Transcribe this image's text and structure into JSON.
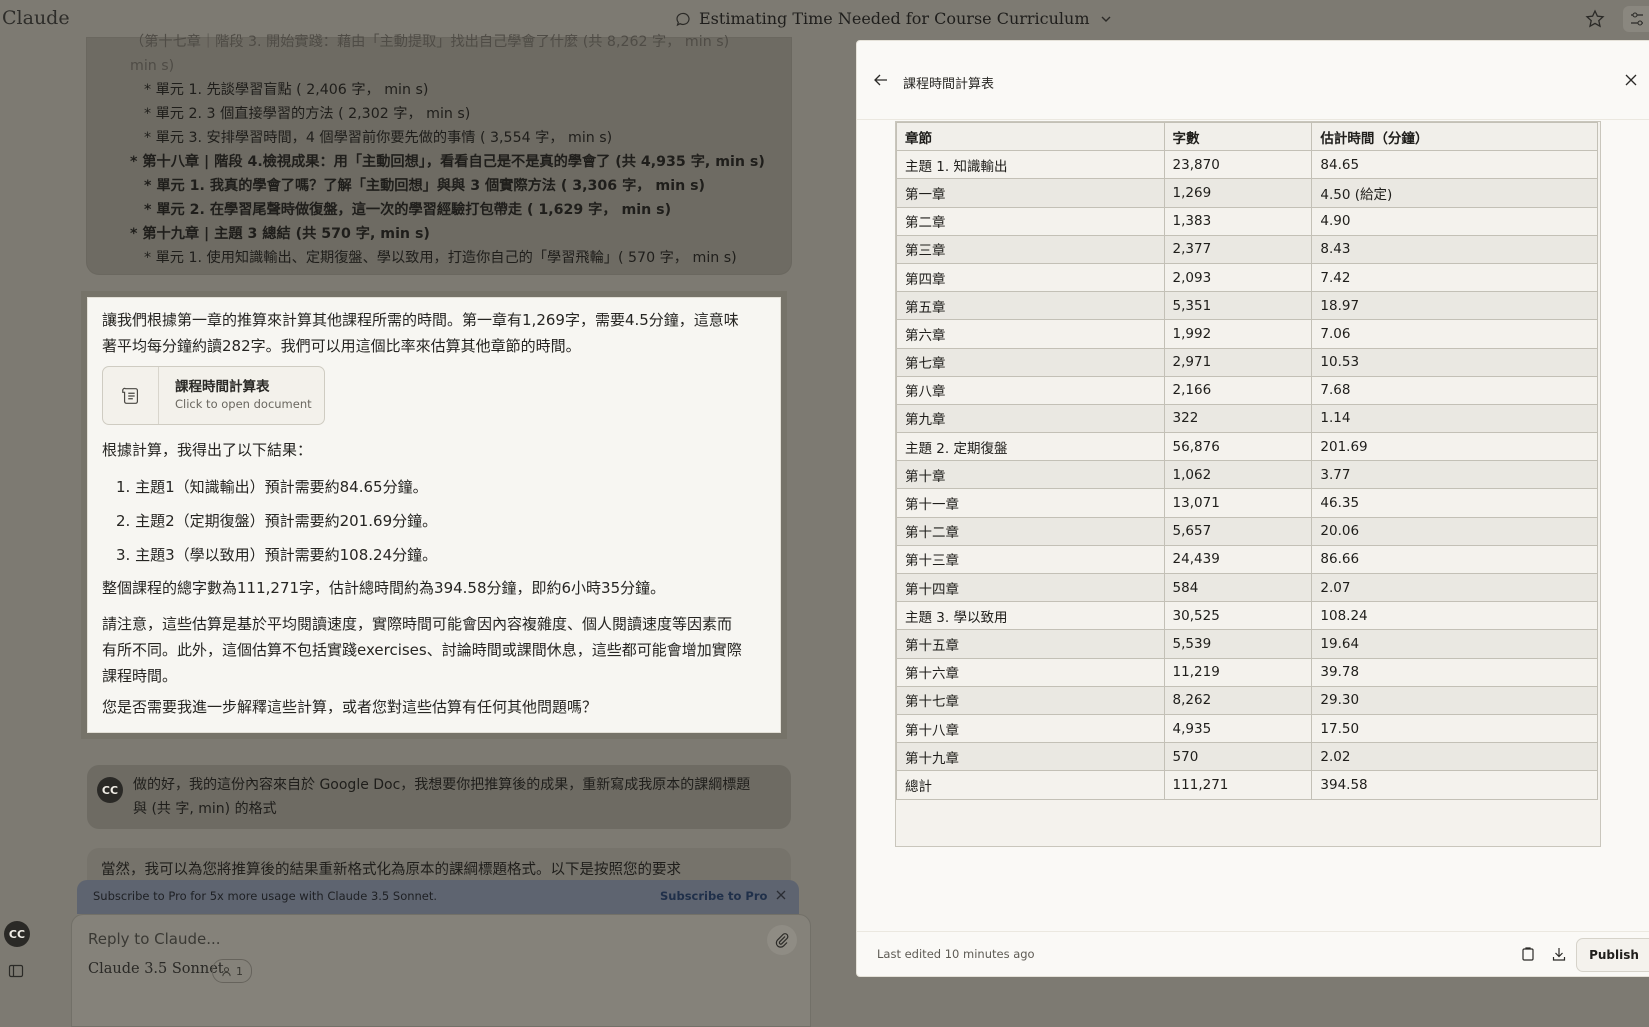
{
  "app": {
    "brand": "Claude",
    "conversation_title": "Estimating Time Needed for Course Curriculum"
  },
  "outline_lines": [
    {
      "text": "（第十七章｜階段 3. 開始實踐：藉由「主動提取」找出自己學會了什麼 (共 8,262 字， min s)",
      "style": "faded"
    },
    {
      "text": "min s)",
      "style": "faded"
    },
    {
      "text": "* 單元 1. 先談學習盲點 ( 2,406 字， min s)",
      "style": "sub"
    },
    {
      "text": "* 單元 2. 3 個直接學習的方法 ( 2,302 字， min s)",
      "style": "sub"
    },
    {
      "text": "* 單元 3. 安排學習時間，4 個學習前你要先做的事情 ( 3,554 字， min s)",
      "style": "sub"
    },
    {
      "text": "* 第十八章 | 階段 4.檢視成果：用「主動回想」，看看自己是不是真的學會了 (共 4,935 字, min s)",
      "style": "bold"
    },
    {
      "text": "* 單元 1. 我真的學會了嗎？了解「主動回想」與與 3 個實際方法 ( 3,306 字， min s)",
      "style": "sub bold"
    },
    {
      "text": "* 單元 2. 在學習尾聲時做復盤，這一次的學習經驗打包帶走 ( 1,629 字， min s)",
      "style": "sub bold"
    },
    {
      "text": "* 第十九章 | 主題 3 總結 (共 570 字, min s)",
      "style": "bold"
    },
    {
      "text": "* 單元 1. 使用知識輸出、定期復盤、學以致用，打造你自己的「學習飛輪」( 570 字， min s)",
      "style": "sub"
    }
  ],
  "ai_message": {
    "intro": "讓我們根據第一章的推算來計算其他課程所需的時間。第一章有1,269字，需要4.5分鐘，這意味著平均每分鐘約讀282字。我們可以用這個比率來估算其他章節的時間。",
    "artifact_chip": {
      "title": "課程時間計算表",
      "subtitle": "Click to open document"
    },
    "results_intro": "根據計算，我得出了以下結果：",
    "results": [
      "1. 主題1（知識輸出）預計需要約84.65分鐘。",
      "2. 主題2（定期復盤）預計需要約201.69分鐘。",
      "3. 主題3（學以致用）預計需要約108.24分鐘。"
    ],
    "total": "整個課程的總字數為111,271字，估計總時間約為394.58分鐘，即約6小時35分鐘。",
    "note": "請注意，這些估算是基於平均閱讀速度，實際時間可能會因內容複雜度、個人閱讀速度等因素而有所不同。此外，這個估算不包括實踐exercises、討論時間或課間休息，這些都可能會增加實際課程時間。",
    "question": "您是否需要我進一步解釋這些計算，或者您對這些估算有任何其他問題嗎？"
  },
  "user_message2": {
    "avatar": "CC",
    "text": "做的好，我的這份內容來自於 Google Doc，我想要你把推算後的成果，重新寫成我原本的課綱標題與 (共 字, min) 的格式"
  },
  "ai_message2_preview": "當然，我可以為您將推算後的結果重新格式化為原本的課綱標題格式。以下是按照您的要求",
  "promo": {
    "text": "Subscribe to Pro for 5x more usage with Claude 3.5 Sonnet.",
    "link": "Subscribe to Pro"
  },
  "composer": {
    "placeholder": "Reply to Claude...",
    "model": "Claude 3.5 Sonnet",
    "badge_count": "1"
  },
  "left_avatar": "CC",
  "artifact": {
    "title": "課程時間計算表",
    "columns": [
      "章節",
      "字數",
      "估計時間（分鐘）"
    ],
    "rows": [
      [
        "主題 1. 知識輸出",
        "23,870",
        "84.65"
      ],
      [
        "第一章",
        "1,269",
        "4.50 (給定)"
      ],
      [
        "第二章",
        "1,383",
        "4.90"
      ],
      [
        "第三章",
        "2,377",
        "8.43"
      ],
      [
        "第四章",
        "2,093",
        "7.42"
      ],
      [
        "第五章",
        "5,351",
        "18.97"
      ],
      [
        "第六章",
        "1,992",
        "7.06"
      ],
      [
        "第七章",
        "2,971",
        "10.53"
      ],
      [
        "第八章",
        "2,166",
        "7.68"
      ],
      [
        "第九章",
        "322",
        "1.14"
      ],
      [
        "主題 2. 定期復盤",
        "56,876",
        "201.69"
      ],
      [
        "第十章",
        "1,062",
        "3.77"
      ],
      [
        "第十一章",
        "13,071",
        "46.35"
      ],
      [
        "第十二章",
        "5,657",
        "20.06"
      ],
      [
        "第十三章",
        "24,439",
        "86.66"
      ],
      [
        "第十四章",
        "584",
        "2.07"
      ],
      [
        "主題 3. 學以致用",
        "30,525",
        "108.24"
      ],
      [
        "第十五章",
        "5,539",
        "19.64"
      ],
      [
        "第十六章",
        "11,219",
        "39.78"
      ],
      [
        "第十七章",
        "8,262",
        "29.30"
      ],
      [
        "第十八章",
        "4,935",
        "17.50"
      ],
      [
        "第十九章",
        "570",
        "2.02"
      ],
      [
        "總計",
        "111,271",
        "394.58"
      ]
    ],
    "footer": {
      "last_edited": "Last edited 10 minutes ago",
      "publish_label": "Publish"
    }
  }
}
